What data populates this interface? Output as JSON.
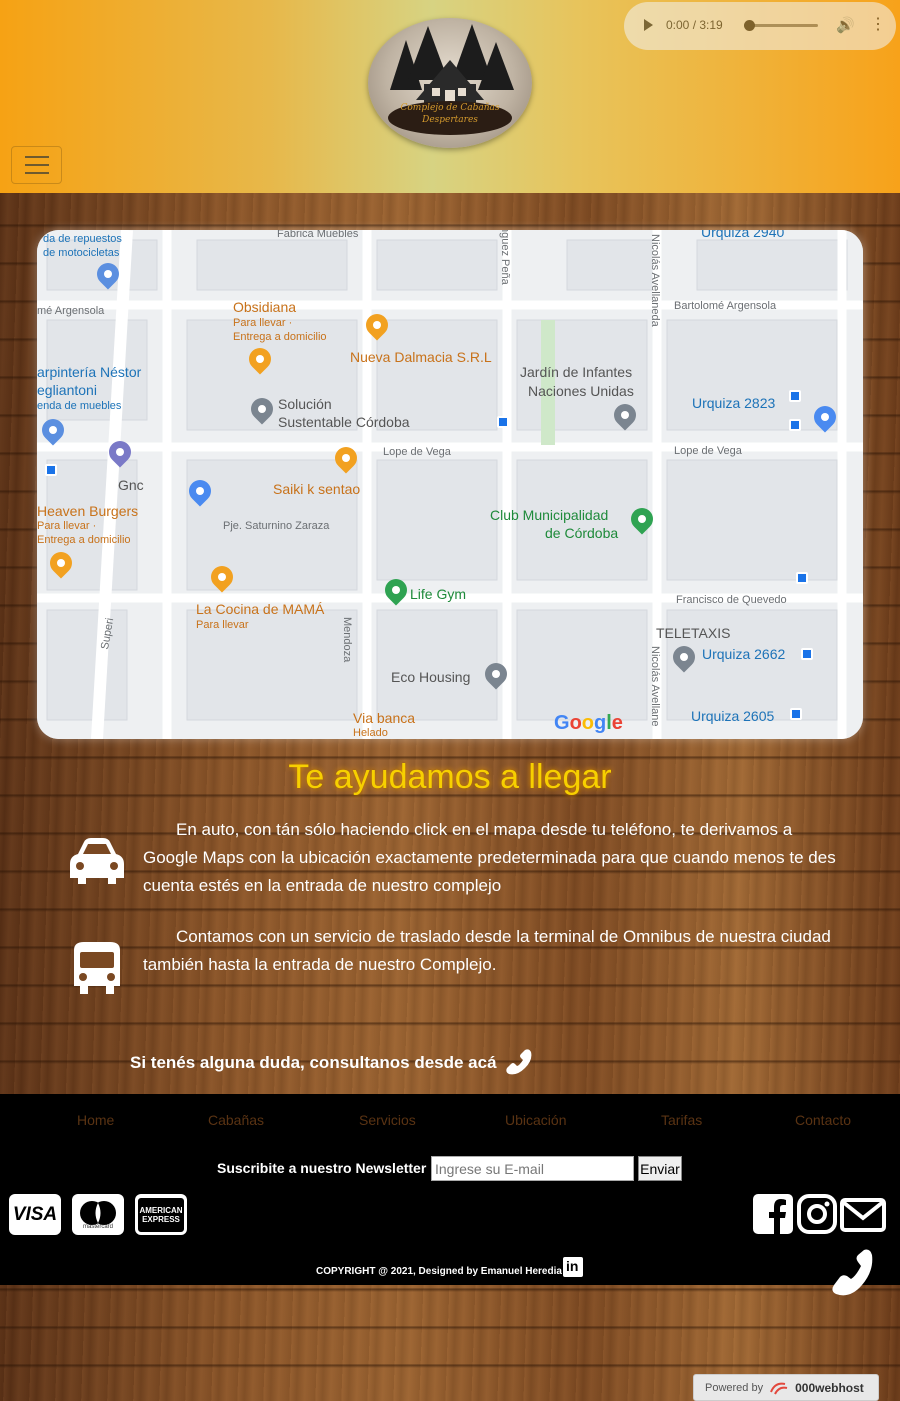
{
  "audio": {
    "time": "0:00 / 3:19",
    "progress": 0,
    "play_icon": "play-icon",
    "volume_icon": "volume-icon",
    "more_icon": "more-vertical-icon"
  },
  "logo": {
    "line1": "Complejo de Cabañas",
    "line2": "Despertares"
  },
  "map": {
    "labels": {
      "fabrica": "Fabrica Muebles",
      "urquiza2940": "Urquiza 2940",
      "repuestos1": "da de repuestos",
      "repuestos2": "de motocicletas",
      "argensola_w": "mé Argensola",
      "argensola_e": "Bartolomé Argensola",
      "obsidiana": "Obsidiana",
      "obsidiana_sub1": "Para llevar ·",
      "obsidiana_sub2": "Entrega a domicilio",
      "dalmacia": "Nueva Dalmacia S.R.L",
      "jardin1": "Jardín de Infantes",
      "jardin2": "Naciones Unidas",
      "carpinteria1": "arpintería Néstor",
      "carpinteria2": "egliantoni",
      "carpinteria3": "enda de muebles",
      "solucion1": "Solución",
      "solucion2": "Sustentable Córdoba",
      "urquiza2823": "Urquiza 2823",
      "lope_w": "Lope de Vega",
      "lope_e": "Lope de Vega",
      "gnc": "Gnc",
      "saiki": "Saiki k sentao",
      "heaven1": "Heaven Burgers",
      "heaven2": "Para llevar ·",
      "heaven3": "Entrega a domicilio",
      "saturnino": "Pje. Saturnino Zaraza",
      "club1": "Club Municipalidad",
      "club2": "de Córdoba",
      "quevedo": "Francisco de Quevedo",
      "lifegym": "Life Gym",
      "cocina1": "La Cocina de MAMÁ",
      "cocina2": "Para llevar",
      "teletaxis": "TELETAXIS",
      "urquiza2662": "Urquiza 2662",
      "eco": "Eco Housing",
      "viabanca1": "Via banca",
      "viabanca2": "Helado",
      "urquiza2605": "Urquiza 2605",
      "mendoza": "Mendoza",
      "superi": "Superi",
      "penia": "nguez Peña",
      "avellaneda_n": "Nicolás Avellaneda",
      "avellaneda_s": "Nicolás Avellane",
      "google": "Google"
    }
  },
  "content": {
    "title": "Te ayudamos a llegar",
    "p1": "En auto, con tán sólo haciendo click en el mapa desde tu teléfono, te derivamos a Google Maps con la ubicación exactamente predeterminada para que cuando menos te des cuenta estés en la entrada de nuestro complejo",
    "p2": "Contamos con un servicio de traslado desde la terminal de Omnibus de nuestra ciudad también hasta la entrada de nuestro Complejo.",
    "doubt": "Si tenés alguna duda, consultanos desde acá"
  },
  "footer": {
    "nav": [
      "Home",
      "Cabañas",
      "Servicios",
      "Ubicación",
      "Tarifas",
      "Contacto"
    ],
    "newsletter_label": "Suscribite a nuestro Newsletter",
    "newsletter_placeholder": "Ingrese su E-mail",
    "newsletter_button": "Enviar",
    "cards": {
      "visa": "VISA",
      "mastercard": "mastercard",
      "amex1": "AMERICAN",
      "amex2": "EXPRESS"
    },
    "copyright": "COPYRIGHT @ 2021, Designed by Emanuel Heredia",
    "linkedin": "in"
  },
  "powered": {
    "prefix": "Powered by",
    "host": "000webhost"
  },
  "colors": {
    "title": "#f7d000",
    "header_left": "#f6a214",
    "footer_bg": "#000000",
    "nav_link": "#5a3313"
  }
}
